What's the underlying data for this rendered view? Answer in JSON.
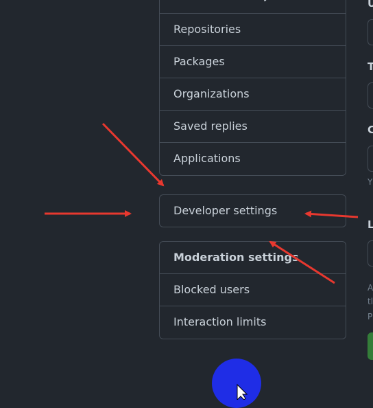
{
  "menu_settings": {
    "items": [
      "SSH and GPG keys",
      "Repositories",
      "Packages",
      "Organizations",
      "Saved replies",
      "Applications"
    ]
  },
  "developer": {
    "label": "Developer settings"
  },
  "moderation": {
    "header": "Moderation settings",
    "items": [
      "Blocked users",
      "Interaction limits"
    ]
  },
  "right_panel": {
    "labels": [
      "U",
      "T",
      "C",
      "L"
    ],
    "small": [
      "Y",
      "A",
      "tl",
      "P"
    ]
  },
  "annotation_colors": {
    "arrow": "#e8382f",
    "circle": "#1f2de6"
  }
}
